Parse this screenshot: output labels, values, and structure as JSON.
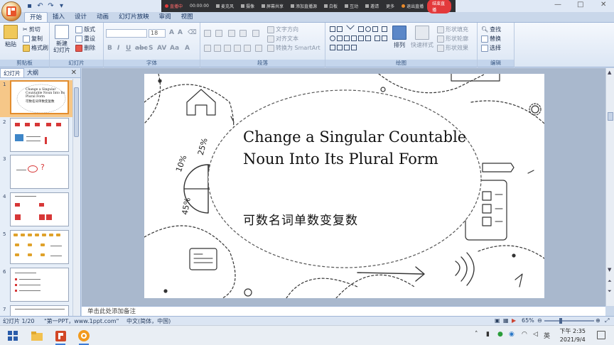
{
  "recording_bar": {
    "live_label": "直播中",
    "timer": "00:00:00",
    "items": [
      "麦克风",
      "摄像",
      "屏幕共享",
      "添加直播源",
      "白板",
      "互动",
      "邀请",
      "更多"
    ],
    "exit_label": "退出直播",
    "stop_label": "结束直播"
  },
  "title_bar": {
    "minimize": "—",
    "maximize": "□",
    "close": "✕"
  },
  "tabs": [
    "开始",
    "插入",
    "设计",
    "动画",
    "幻灯片放映",
    "审阅",
    "视图"
  ],
  "active_tab": "开始",
  "ribbon": {
    "groups": {
      "clipboard": "剪贴板",
      "slides": "幻灯片",
      "font": "字体",
      "paragraph": "段落",
      "drawing": "绘图",
      "editing": "编辑"
    },
    "clipboard": {
      "paste": "粘贴",
      "cut": "剪切",
      "copy": "复制",
      "format_painter": "格式刷"
    },
    "slides": {
      "new_slide": "新建\n幻灯片",
      "layout": "版式",
      "reset": "重设",
      "delete": "删除"
    },
    "font": {
      "font_name": "",
      "font_size": "18"
    },
    "paragraph": {
      "text_direction": "文字方向",
      "align_text": "对齐文本",
      "smartart": "转换为 SmartArt"
    },
    "drawing": {
      "arrange": "排列",
      "quick_styles": "快速样式",
      "shape_fill": "形状填充",
      "shape_outline": "形状轮廓",
      "shape_effects": "形状效果"
    },
    "editing": {
      "find": "查找",
      "replace": "替换",
      "select": "选择"
    }
  },
  "left_panel": {
    "tab_slides": "幻灯片",
    "tab_outline": "大纲",
    "close": "✕",
    "thumbnails": [
      {
        "num": "1",
        "title_line1": "Change a Singular",
        "title_line2": "Countable Noun Into Its",
        "title_line3": "Plural Form",
        "subtitle": "可数名词单数变复数"
      },
      {
        "num": "2"
      },
      {
        "num": "3"
      },
      {
        "num": "4"
      },
      {
        "num": "5"
      },
      {
        "num": "6"
      },
      {
        "num": "7"
      }
    ]
  },
  "slide": {
    "title": "Change a Singular Countable Noun Into Its Plural Form",
    "subtitle": "可数名词单数变复数",
    "percent_label_1": "10%",
    "percent_label_2": "25%",
    "percent_label_3": "45%"
  },
  "notes": {
    "placeholder": "单击此处添加备注"
  },
  "status_bar": {
    "slide_info": "幻灯片 1/20",
    "theme": "\"第一PPT，www.1ppt.com\"",
    "language": "中文(简体，中国)",
    "zoom": "65%"
  },
  "taskbar": {
    "time": "下午 2:35",
    "date": "2021/9/4",
    "ime": "英"
  }
}
